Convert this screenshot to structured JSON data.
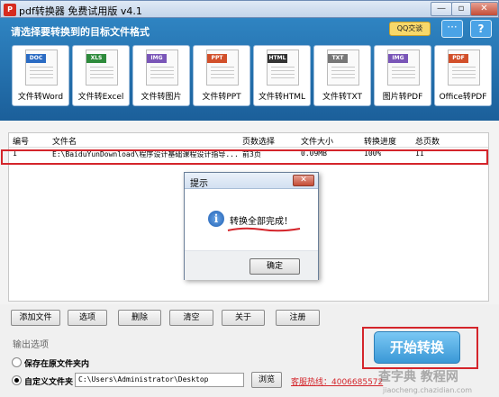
{
  "window": {
    "title": "pdf转换器 免费试用版 v4.1",
    "minimize": "—",
    "maximize": "▫",
    "close": "✕",
    "app_icon_text": "P"
  },
  "format_area": {
    "heading": "请选择要转换到的目标文件格式",
    "qq_label": "QQ交谈",
    "chat_icon": "···",
    "help_icon": "?",
    "formats": [
      {
        "tag": "DOC",
        "label": "文件转Word",
        "color": "#2b6cc4"
      },
      {
        "tag": "XLS",
        "label": "文件转Excel",
        "color": "#2e8b3c"
      },
      {
        "tag": "IMG",
        "label": "文件转图片",
        "color": "#7a56b8"
      },
      {
        "tag": "PPT",
        "label": "文件转PPT",
        "color": "#d2502b"
      },
      {
        "tag": "HTML",
        "label": "文件转HTML",
        "color": "#333333"
      },
      {
        "tag": "TXT",
        "label": "文件转TXT",
        "color": "#777777"
      },
      {
        "tag": "IMG",
        "label": "图片转PDF",
        "color": "#7a56b8"
      },
      {
        "tag": "PDF",
        "label": "Office转PDF",
        "color": "#d2502b"
      }
    ]
  },
  "file_table": {
    "headers": [
      "编号",
      "文件名",
      "页数选择",
      "文件大小",
      "转换进度",
      "总页数"
    ],
    "rows": [
      {
        "num": "1",
        "filename": "E:\\BaiduYunDownload\\程序设计基础课程设计指导...",
        "pages": "前3页",
        "size": "0.09MB",
        "progress": "100%",
        "total": "11"
      }
    ]
  },
  "dialog": {
    "title": "提示",
    "close": "✕",
    "icon": "i",
    "message": "转换全部完成！",
    "ok_label": "确定"
  },
  "toolbar": {
    "add_file": "添加文件",
    "options": "选项",
    "delete": "删除",
    "clear": "清空",
    "about": "关于",
    "register": "注册"
  },
  "output": {
    "section_label": "输出选项",
    "option_original": "保存在原文件夹内",
    "option_custom": "自定义文件夹",
    "custom_path": "C:\\Users\\Administrator\\Desktop",
    "browse_label": "浏览",
    "selected": "custom"
  },
  "hotline": "客服热线：4006685572",
  "start_label": "开始转换",
  "watermark": "查字典 教程网",
  "watermark_url": "jiaocheng.chazidian.com"
}
